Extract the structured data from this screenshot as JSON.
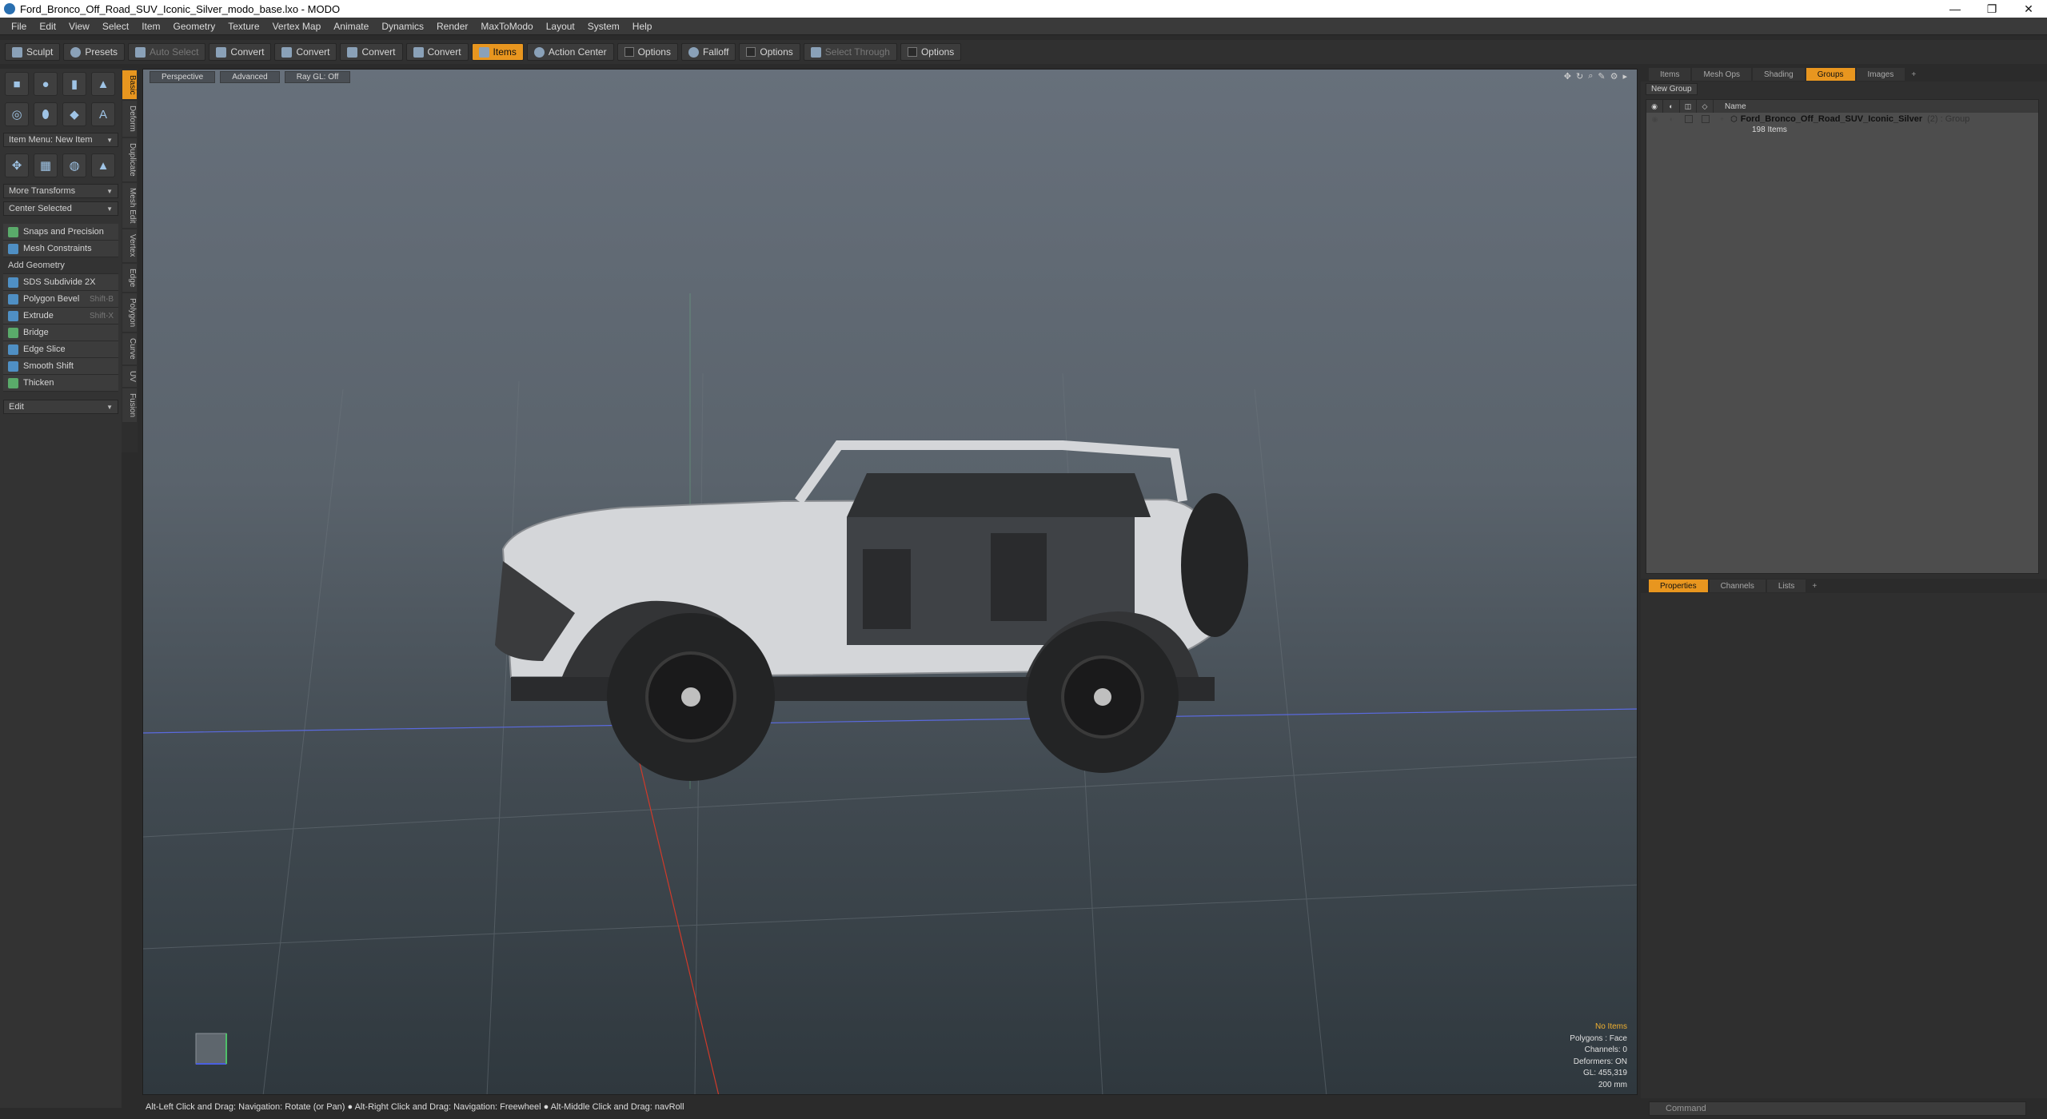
{
  "window": {
    "title": "Ford_Bronco_Off_Road_SUV_Iconic_Silver_modo_base.lxo - MODO",
    "controls": [
      "—",
      "❐",
      "✕"
    ]
  },
  "menu": [
    "File",
    "Edit",
    "View",
    "Select",
    "Item",
    "Geometry",
    "Texture",
    "Vertex Map",
    "Animate",
    "Dynamics",
    "Render",
    "MaxToModo",
    "Layout",
    "System",
    "Help"
  ],
  "toolbar": {
    "sculpt": "Sculpt",
    "presets": "Presets",
    "auto_select": "Auto Select",
    "convert1": "Convert",
    "convert2": "Convert",
    "convert3": "Convert",
    "convert4": "Convert",
    "items": "Items",
    "action_center": "Action Center",
    "options1": "Options",
    "falloff": "Falloff",
    "options2": "Options",
    "select_through": "Select Through",
    "options3": "Options"
  },
  "left": {
    "item_menu": "Item Menu: New Item",
    "more_transforms": "More Transforms",
    "center_selected": "Center Selected",
    "snaps": "Snaps and Precision",
    "mesh_constraints": "Mesh Constraints",
    "add_geometry": "Add Geometry",
    "tools": [
      {
        "label": "SDS Subdivide 2X",
        "shortcut": ""
      },
      {
        "label": "Polygon Bevel",
        "shortcut": "Shift-B"
      },
      {
        "label": "Extrude",
        "shortcut": "Shift-X"
      },
      {
        "label": "Bridge",
        "shortcut": ""
      },
      {
        "label": "Edge Slice",
        "shortcut": ""
      },
      {
        "label": "Smooth Shift",
        "shortcut": ""
      },
      {
        "label": "Thicken",
        "shortcut": ""
      }
    ],
    "edit": "Edit",
    "vtabs": [
      "Basic",
      "Deform",
      "Duplicate",
      "Mesh Edit",
      "Vertex",
      "Edge",
      "Polygon",
      "Curve",
      "UV",
      "Fusion"
    ]
  },
  "viewport": {
    "perspective": "Perspective",
    "advanced": "Advanced",
    "raygl": "Ray GL: Off",
    "info": {
      "no_items": "No Items",
      "polygons": "Polygons : Face",
      "channels": "Channels: 0",
      "deformers": "Deformers: ON",
      "gl": "GL: 455,319",
      "scale": "200 mm"
    }
  },
  "right": {
    "top_tabs": [
      "Items",
      "Mesh Ops",
      "Shading",
      "Groups",
      "Images",
      "+"
    ],
    "new_group": "New Group",
    "col_name": "Name",
    "group_name": "Ford_Bronco_Off_Road_SUV_Iconic_Silver",
    "group_type": "(2) : Group",
    "group_items": "198 Items",
    "bottom_tabs": [
      "Properties",
      "Channels",
      "Lists",
      "+"
    ],
    "command_placeholder": "Command"
  },
  "status": "Alt-Left Click and Drag: Navigation: Rotate (or Pan) ● Alt-Right Click and Drag: Navigation: Freewheel ● Alt-Middle Click and Drag: navRoll",
  "colors": {
    "accent": "#e8961f",
    "viewport_top": "#67707b",
    "viewport_bottom": "#2f383e"
  }
}
